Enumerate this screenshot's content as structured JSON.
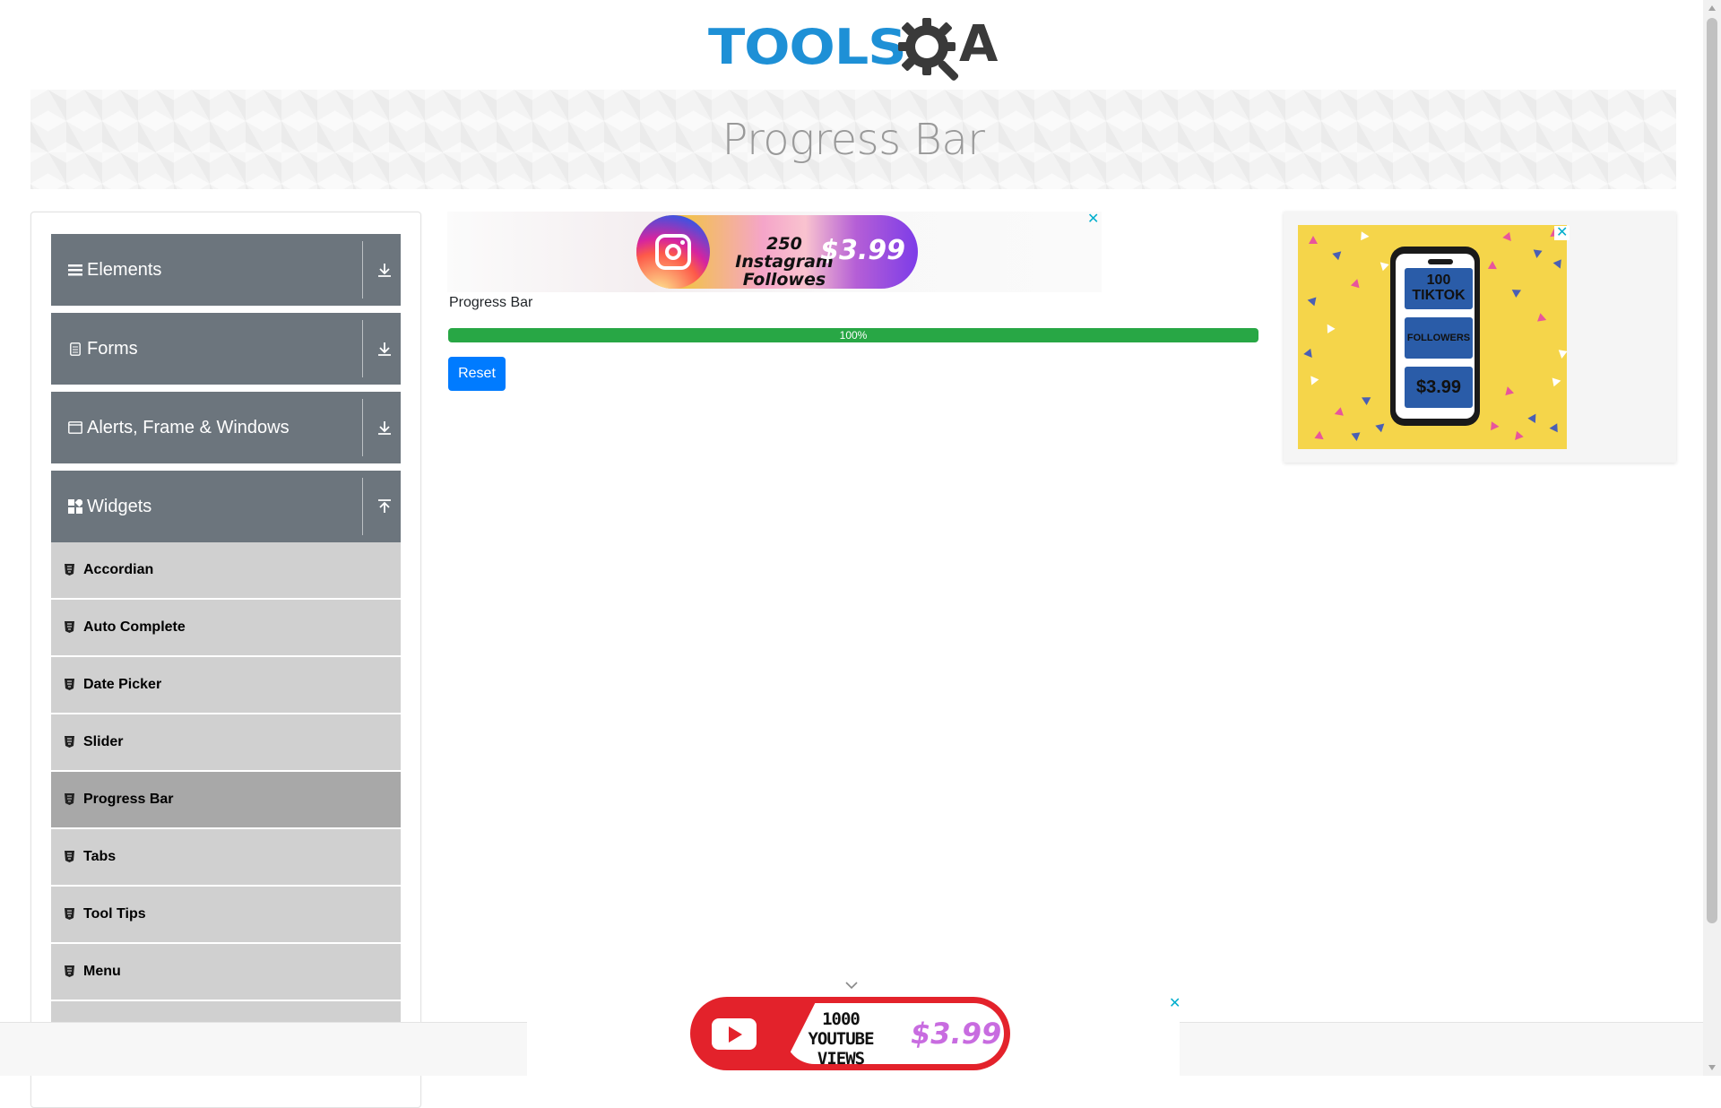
{
  "header": {
    "logo_text_tools": "TOOLS",
    "logo_text_qa": "A",
    "logo_colors": {
      "tools": "#1e90d6",
      "qa": "#3a3a3a"
    }
  },
  "banner": {
    "title": "Progress Bar"
  },
  "sidebar": {
    "groups": [
      {
        "label": "Elements",
        "icon": "list-icon",
        "expanded": false
      },
      {
        "label": "Forms",
        "icon": "document-icon",
        "expanded": false
      },
      {
        "label": "Alerts, Frame & Windows",
        "icon": "window-icon",
        "expanded": false
      },
      {
        "label": "Widgets",
        "icon": "widgets-icon",
        "expanded": true
      }
    ],
    "widget_items": [
      {
        "label": "Accordian",
        "active": false
      },
      {
        "label": "Auto Complete",
        "active": false
      },
      {
        "label": "Date Picker",
        "active": false
      },
      {
        "label": "Slider",
        "active": false
      },
      {
        "label": "Progress Bar",
        "active": true
      },
      {
        "label": "Tabs",
        "active": false
      },
      {
        "label": "Tool Tips",
        "active": false
      },
      {
        "label": "Menu",
        "active": false
      },
      {
        "label": "",
        "active": false
      }
    ]
  },
  "main": {
    "section_label": "Progress Bar",
    "progress": {
      "value_percent": 100,
      "text": "100%",
      "color": "#28a745"
    },
    "reset_label": "Reset",
    "accent": "#007bff"
  },
  "ads": {
    "top": {
      "text": "250 Instagram Followes",
      "price": "$3.99",
      "close": "✕"
    },
    "right": {
      "line1": "100",
      "line2": "TIKTOK",
      "line3": "FOLLOWERS",
      "price": "$3.99",
      "close": "✕"
    },
    "bottom": {
      "line1": "1000",
      "line2": "YOUTUBE VIEWS",
      "price": "$3.99",
      "close": "✕"
    }
  }
}
